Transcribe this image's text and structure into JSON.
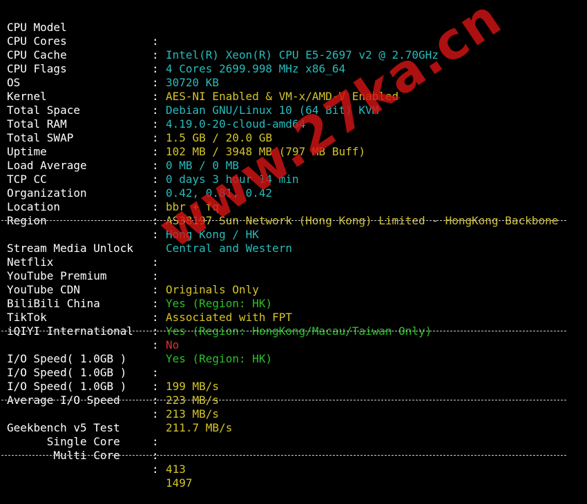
{
  "system": [
    {
      "key": "CPU Model",
      "value": "Intel(R) Xeon(R) CPU E5-2697 v2 @ 2.70GHz",
      "color": "cyan"
    },
    {
      "key": "CPU Cores",
      "value": "4 Cores 2699.998 MHz x86_64",
      "color": "cyan"
    },
    {
      "key": "CPU Cache",
      "value": "30720 KB",
      "color": "cyan"
    },
    {
      "key": "CPU Flags",
      "value": "AES-NI Enabled & VM-x/AMD-V Enabled",
      "color": "yellow"
    },
    {
      "key": "OS",
      "value": "Debian GNU/Linux 10 (64 Bit) KVM",
      "color": "cyan"
    },
    {
      "key": "Kernel",
      "value": "4.19.0-20-cloud-amd64",
      "color": "cyan"
    },
    {
      "key": "Total Space",
      "value": "1.5 GB / 20.0 GB",
      "color": "yellow"
    },
    {
      "key": "Total RAM",
      "value": "102 MB / 3948 MB (797 MB Buff)",
      "color": "yellow"
    },
    {
      "key": "Total SWAP",
      "value": "0 MB / 0 MB",
      "color": "cyan"
    },
    {
      "key": "Uptime",
      "value": "0 days 3 hour 14 min",
      "color": "cyan"
    },
    {
      "key": "Load Average",
      "value": "0.42, 0.81, 0.42",
      "color": "cyan"
    },
    {
      "key": "TCP CC",
      "value": "bbr + fq",
      "color": "yellow"
    },
    {
      "key": "Organization",
      "value": "AS38197 Sun Network (Hong Kong) Limited - HongKong Backbone",
      "color": "yellow"
    },
    {
      "key": "Location",
      "value": "Hong Kong / HK",
      "color": "cyan"
    },
    {
      "key": "Region",
      "value": "Central and Western",
      "color": "cyan"
    }
  ],
  "stream": {
    "title": "Stream Media Unlock",
    "rows": [
      {
        "key": "Netflix",
        "value": "Originals Only",
        "color": "yellow"
      },
      {
        "key": "YouTube Premium",
        "value": "Yes (Region: HK)",
        "color": "green"
      },
      {
        "key": "YouTube CDN",
        "value": "Associated with FPT",
        "color": "yellow"
      },
      {
        "key": "BiliBili China",
        "value": "Yes (Region: HongKong/Macau/Taiwan Only)",
        "color": "green"
      },
      {
        "key": "TikTok",
        "value": "No",
        "color": "red"
      },
      {
        "key": "iQIYI International",
        "value": "Yes (Region: HK)",
        "color": "green"
      }
    ]
  },
  "io": [
    {
      "key": "I/O Speed( 1.0GB )",
      "value": "199 MB/s",
      "color": "yellow"
    },
    {
      "key": "I/O Speed( 1.0GB )",
      "value": "223 MB/s",
      "color": "yellow"
    },
    {
      "key": "I/O Speed( 1.0GB )",
      "value": "213 MB/s",
      "color": "yellow"
    },
    {
      "key": "Average I/O Speed",
      "value": "211.7 MB/s",
      "color": "yellow"
    }
  ],
  "geekbench": {
    "title": "Geekbench v5 Test",
    "rows": [
      {
        "key": "      Single Core",
        "value": "413",
        "color": "yellow"
      },
      {
        "key": "       Multi Core",
        "value": "1497",
        "color": "yellow"
      }
    ]
  },
  "watermark": "www.27ka.cn",
  "colors": {
    "cyan": "#27bcbc",
    "yellow": "#d4c42a",
    "green": "#29c229",
    "red": "#e03030",
    "background": "#000000"
  }
}
